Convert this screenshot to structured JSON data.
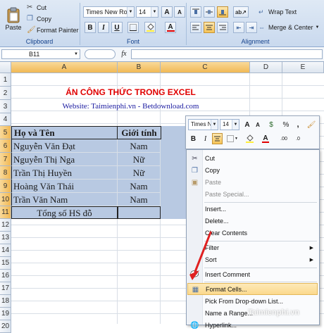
{
  "ribbon": {
    "paste_label": "Paste",
    "cut_label": "Cut",
    "copy_label": "Copy",
    "format_painter_label": "Format Painter",
    "clipboard_group": "Clipboard",
    "font_name": "Times New Rom",
    "font_size": "14",
    "font_group": "Font",
    "bold": "B",
    "italic": "I",
    "underline": "U",
    "grow_font": "A",
    "shrink_font": "A",
    "font_color": "A",
    "wrap_text_label": "Wrap Text",
    "merge_center_label": "Merge & Center",
    "alignment_group": "Alignment"
  },
  "formula_bar": {
    "name_box": "B11",
    "fx": "fx",
    "formula": ""
  },
  "columns": [
    "A",
    "B",
    "C",
    "D",
    "E"
  ],
  "rows": [
    "1",
    "2",
    "3",
    "4",
    "5",
    "6",
    "7",
    "8",
    "9",
    "10",
    "11",
    "12",
    "13",
    "14",
    "15",
    "16",
    "17",
    "18",
    "19",
    "20"
  ],
  "sheet": {
    "title": "ÁN CÔNG THỨC TRONG EXCEL",
    "website": "Website: Taimienphi.vn - Betdownload.com",
    "headers": [
      "Họ và Tên",
      "Giới tính"
    ],
    "students": [
      {
        "name": "Nguyễn Văn Đạt",
        "gender": "Nam"
      },
      {
        "name": "Nguyễn Thị Nga",
        "gender": "Nữ"
      },
      {
        "name": "Trần Thị Huyền",
        "gender": "Nữ"
      },
      {
        "name": "Hoàng Văn Thái",
        "gender": "Nam"
      },
      {
        "name": "Trần Văn Nam",
        "gender": "Nam"
      }
    ],
    "total_label": "Tổng số HS đỗ"
  },
  "mini_toolbar": {
    "font_name": "Times Ne",
    "font_size": "14",
    "grow": "A",
    "shrink": "A",
    "currency": "$",
    "percent": "%",
    "comma": ",",
    "bold": "B",
    "italic": "I",
    "font_color": "A",
    "decimal_inc": ".0",
    "decimal_dec": ".00"
  },
  "context_menu": {
    "cut": "Cut",
    "copy": "Copy",
    "paste": "Paste",
    "paste_special": "Paste Special...",
    "insert": "Insert...",
    "delete": "Delete...",
    "clear_contents": "Clear Contents",
    "filter": "Filter",
    "sort": "Sort",
    "insert_comment": "Insert Comment",
    "format_cells": "Format Cells...",
    "pick_list": "Pick From Drop-down List...",
    "name_range": "Name a Range...",
    "hyperlink": "Hyperlink..."
  },
  "watermark": "Taimienphi.vn",
  "colors": {
    "title_red": "#e00000",
    "website_blue": "#1a1aa0",
    "selection": "#b8c9e2",
    "header_highlight": "#f1b955",
    "arrow_red": "#e02020",
    "hover_orange": "#fbd98d"
  }
}
